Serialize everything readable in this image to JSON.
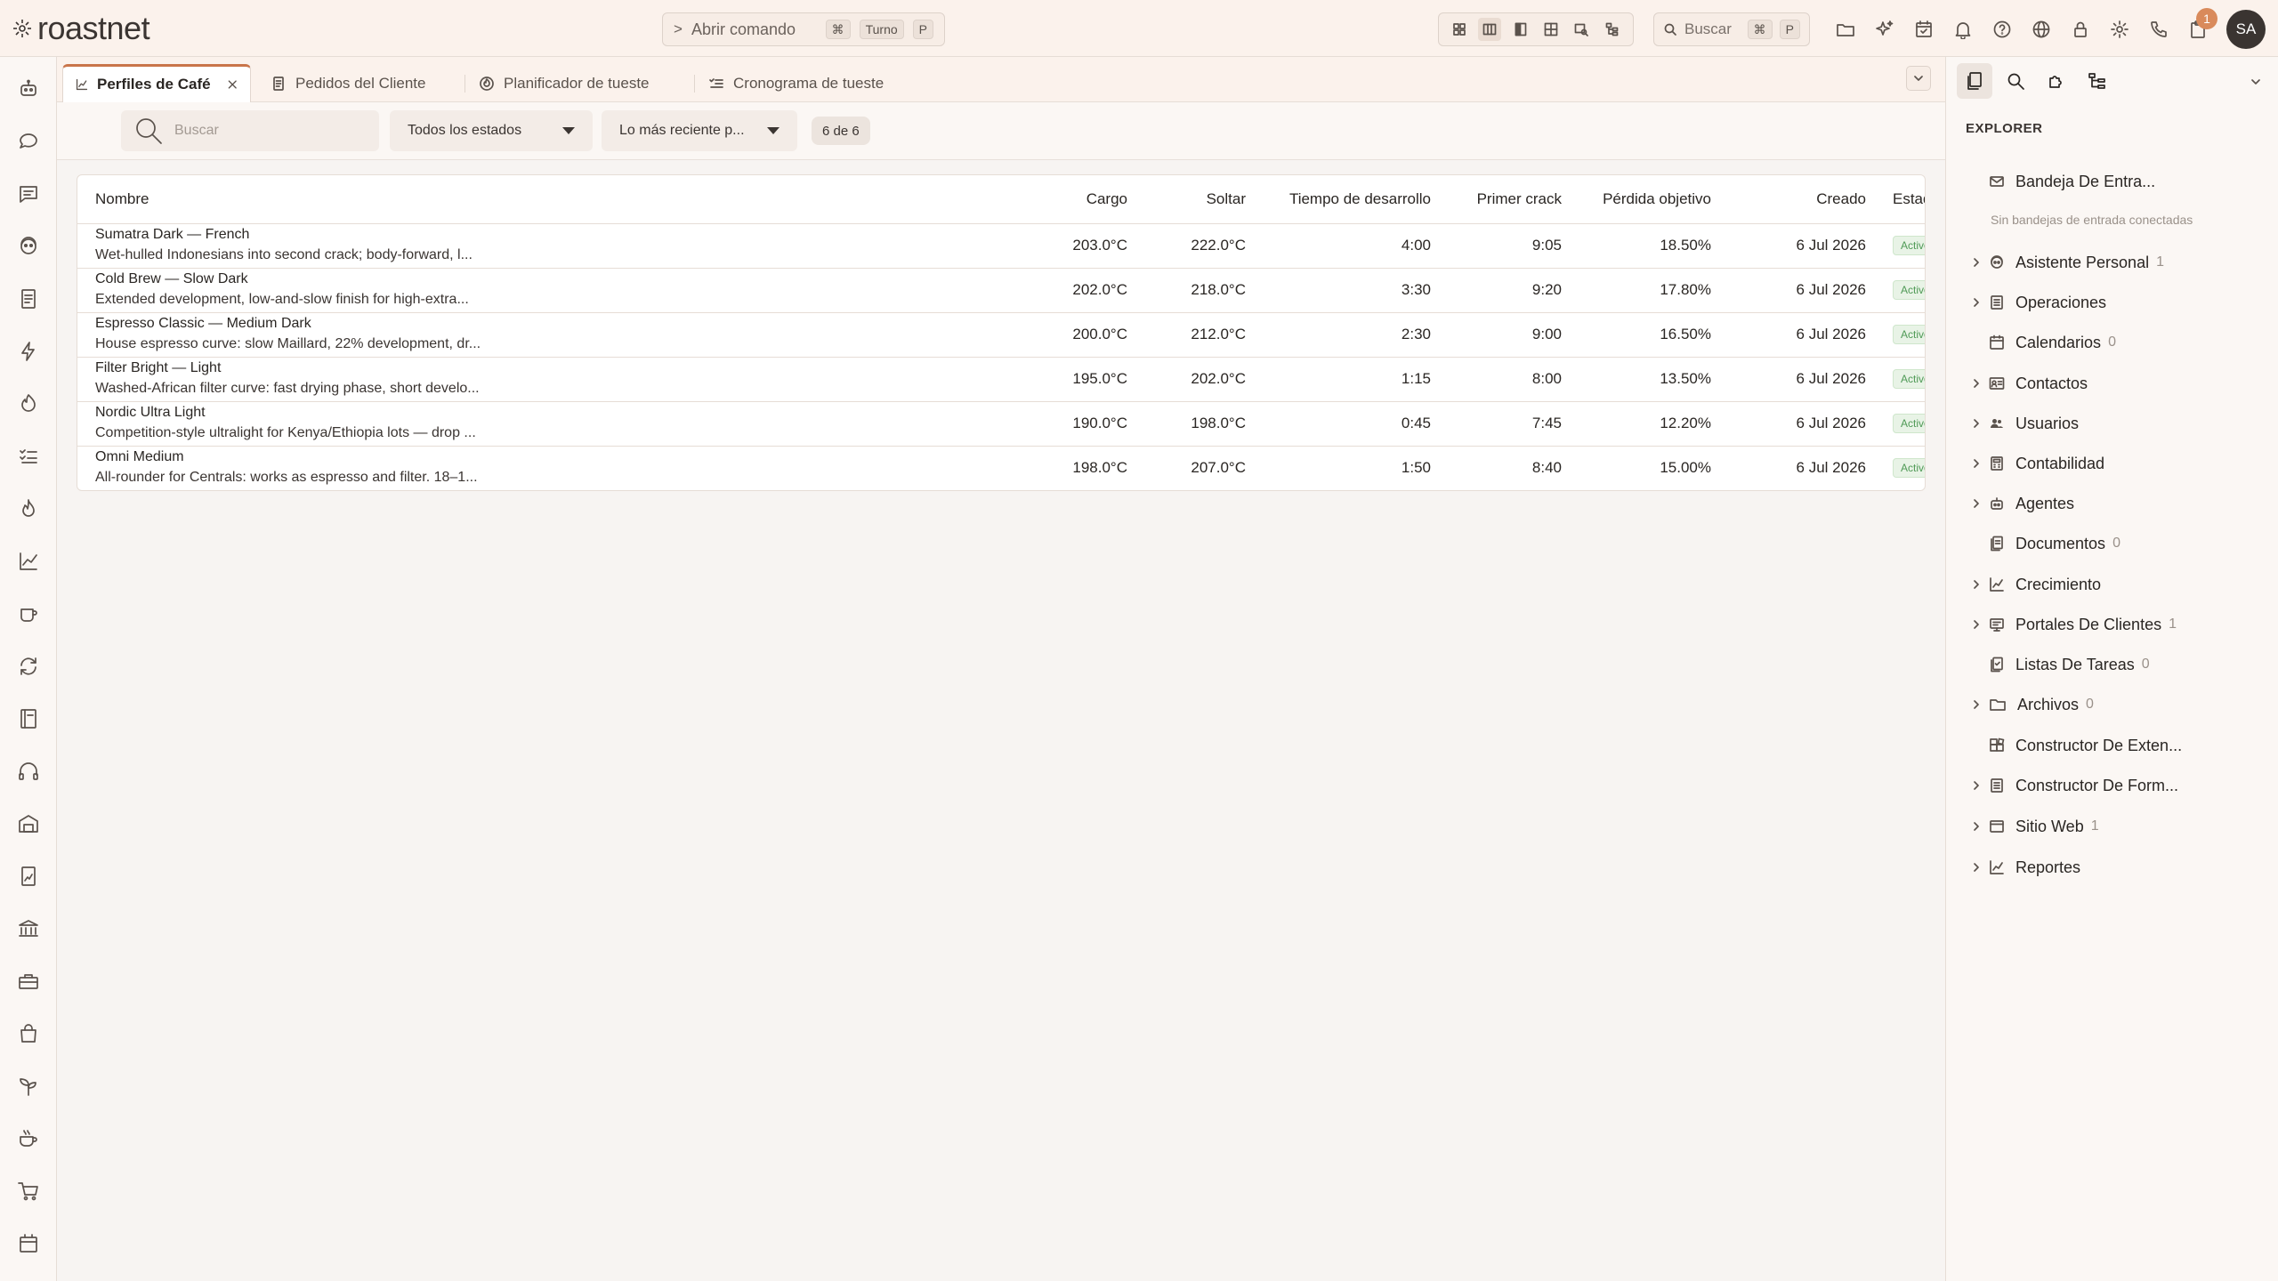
{
  "app": {
    "name": "roastnet"
  },
  "command_bar": {
    "chevron": ">",
    "label": "Abrir comando",
    "key_cmd": "⌘",
    "key_turno": "Turno",
    "key_p": "P"
  },
  "top_search": {
    "label": "Buscar",
    "key_cmd": "⌘",
    "key_p": "P"
  },
  "notifications": {
    "count": "1"
  },
  "user": {
    "initials": "SA"
  },
  "tabs": [
    {
      "label": "Perfiles de Café",
      "icon": "chart-line-icon",
      "active": true
    },
    {
      "label": "Pedidos del Cliente",
      "icon": "document-icon",
      "active": false
    },
    {
      "label": "Planificador de tueste",
      "icon": "flame-icon",
      "active": false
    },
    {
      "label": "Cronograma de tueste",
      "icon": "list-icon",
      "active": false
    }
  ],
  "filters": {
    "search_placeholder": "Buscar",
    "status_select": "Todos los estados",
    "sort_select": "Lo más reciente p...",
    "count": "6 de 6"
  },
  "table": {
    "columns": [
      "Nombre",
      "Cargo",
      "Soltar",
      "Tiempo de desarrollo",
      "Primer crack",
      "Pérdida objetivo",
      "Creado",
      "Estado"
    ],
    "rows": [
      {
        "name": "Sumatra Dark — French",
        "desc": "Wet-hulled Indonesians into second crack; body-forward, l...",
        "cargo": "203.0°C",
        "soltar": "222.0°C",
        "dev": "4:00",
        "crack": "9:05",
        "loss": "18.50%",
        "created": "6 Jul 2026",
        "status": "Activo"
      },
      {
        "name": "Cold Brew — Slow Dark",
        "desc": "Extended development, low-and-slow finish for high-extra...",
        "cargo": "202.0°C",
        "soltar": "218.0°C",
        "dev": "3:30",
        "crack": "9:20",
        "loss": "17.80%",
        "created": "6 Jul 2026",
        "status": "Activo"
      },
      {
        "name": "Espresso Classic — Medium Dark",
        "desc": "House espresso curve: slow Maillard, 22% development, dr...",
        "cargo": "200.0°C",
        "soltar": "212.0°C",
        "dev": "2:30",
        "crack": "9:00",
        "loss": "16.50%",
        "created": "6 Jul 2026",
        "status": "Activo"
      },
      {
        "name": "Filter Bright — Light",
        "desc": "Washed-African filter curve: fast drying phase, short develo...",
        "cargo": "195.0°C",
        "soltar": "202.0°C",
        "dev": "1:15",
        "crack": "8:00",
        "loss": "13.50%",
        "created": "6 Jul 2026",
        "status": "Activo"
      },
      {
        "name": "Nordic Ultra Light",
        "desc": "Competition-style ultralight for Kenya/Ethiopia lots — drop ...",
        "cargo": "190.0°C",
        "soltar": "198.0°C",
        "dev": "0:45",
        "crack": "7:45",
        "loss": "12.20%",
        "created": "6 Jul 2026",
        "status": "Activo"
      },
      {
        "name": "Omni Medium",
        "desc": "All-rounder for Centrals: works as espresso and filter. 18–1...",
        "cargo": "198.0°C",
        "soltar": "207.0°C",
        "dev": "1:50",
        "crack": "8:40",
        "loss": "15.00%",
        "created": "6 Jul 2026",
        "status": "Activo"
      }
    ]
  },
  "explorer": {
    "title": "EXPLORER",
    "inbox": {
      "label": "Bandeja De Entra...",
      "note": "Sin bandejas de entrada conectadas"
    },
    "items": [
      {
        "label": "Asistente Personal",
        "count": "1",
        "icon": "assistant-icon",
        "expandable": true
      },
      {
        "label": "Operaciones",
        "count": "",
        "icon": "operations-icon",
        "expandable": true
      },
      {
        "label": "Calendarios",
        "count": "0",
        "icon": "calendar-icon",
        "expandable": false
      },
      {
        "label": "Contactos",
        "count": "",
        "icon": "contacts-icon",
        "expandable": true
      },
      {
        "label": "Usuarios",
        "count": "",
        "icon": "users-icon",
        "expandable": true
      },
      {
        "label": "Contabilidad",
        "count": "",
        "icon": "accounting-icon",
        "expandable": true
      },
      {
        "label": "Agentes",
        "count": "",
        "icon": "agents-icon",
        "expandable": true
      },
      {
        "label": "Documentos",
        "count": "0",
        "icon": "documents-icon",
        "expandable": false
      },
      {
        "label": "Crecimiento",
        "count": "",
        "icon": "growth-icon",
        "expandable": true
      },
      {
        "label": "Portales De Clientes",
        "count": "1",
        "icon": "portal-icon",
        "expandable": true
      },
      {
        "label": "Listas De Tareas",
        "count": "0",
        "icon": "tasks-icon",
        "expandable": false
      },
      {
        "label": "Archivos",
        "count": "0",
        "icon": "folder-icon",
        "expandable": true
      },
      {
        "label": "Constructor De Exten...",
        "count": "",
        "icon": "extension-icon",
        "expandable": false
      },
      {
        "label": "Constructor De Form...",
        "count": "",
        "icon": "form-icon",
        "expandable": true
      },
      {
        "label": "Sitio Web",
        "count": "1",
        "icon": "website-icon",
        "expandable": true
      },
      {
        "label": "Reportes",
        "count": "",
        "icon": "reports-icon",
        "expandable": true
      }
    ]
  },
  "colors": {
    "accent": "#c9754a",
    "status_green": "#4f9a56",
    "badge": "#d98a5b"
  }
}
